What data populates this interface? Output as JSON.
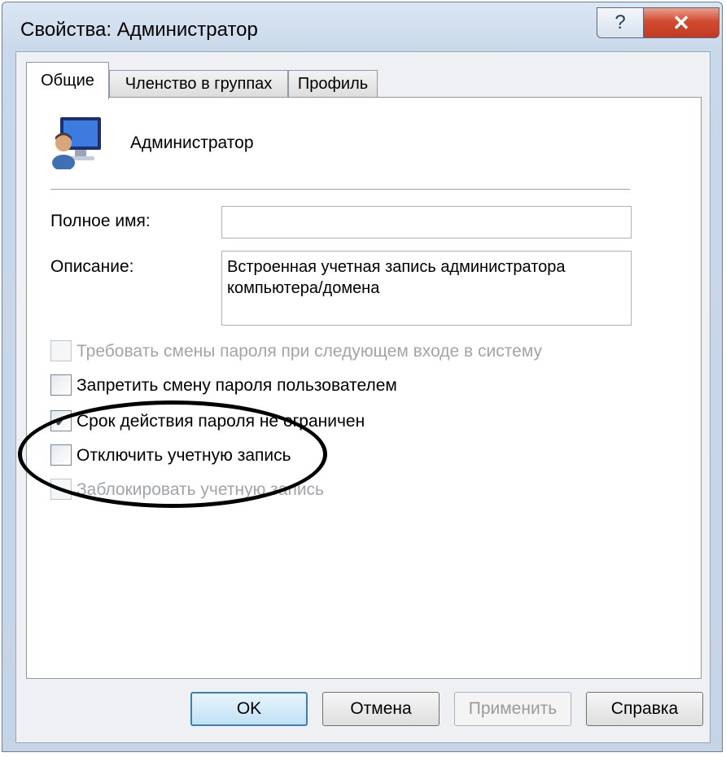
{
  "window": {
    "title": "Свойства: Администратор",
    "help_label": "?",
    "close_label": "✕"
  },
  "tabs": [
    {
      "label": "Общие",
      "active": true
    },
    {
      "label": "Членство в группах",
      "active": false
    },
    {
      "label": "Профиль",
      "active": false
    }
  ],
  "general": {
    "user_name": "Администратор",
    "full_name_label": "Полное имя:",
    "full_name_value": "",
    "description_label": "Описание:",
    "description_value": "Встроенная учетная запись администратора компьютера/домена",
    "options": [
      {
        "label": "Требовать смены пароля при следующем входе в систему",
        "checked": false,
        "enabled": false
      },
      {
        "label": "Запретить смену пароля пользователем",
        "checked": false,
        "enabled": true
      },
      {
        "label": "Срок действия пароля не ограничен",
        "checked": true,
        "enabled": true
      },
      {
        "label": "Отключить учетную запись",
        "checked": false,
        "enabled": true
      },
      {
        "label": "Заблокировать учетную запись",
        "checked": false,
        "enabled": false
      }
    ]
  },
  "buttons": {
    "ok": "OK",
    "cancel": "Отмена",
    "apply": "Применить",
    "help": "Справка"
  },
  "icons": {
    "user": "user-computer-icon",
    "check": "checkmark-icon"
  },
  "colors": {
    "annotation": "#000000",
    "close_button": "#c8452b"
  }
}
